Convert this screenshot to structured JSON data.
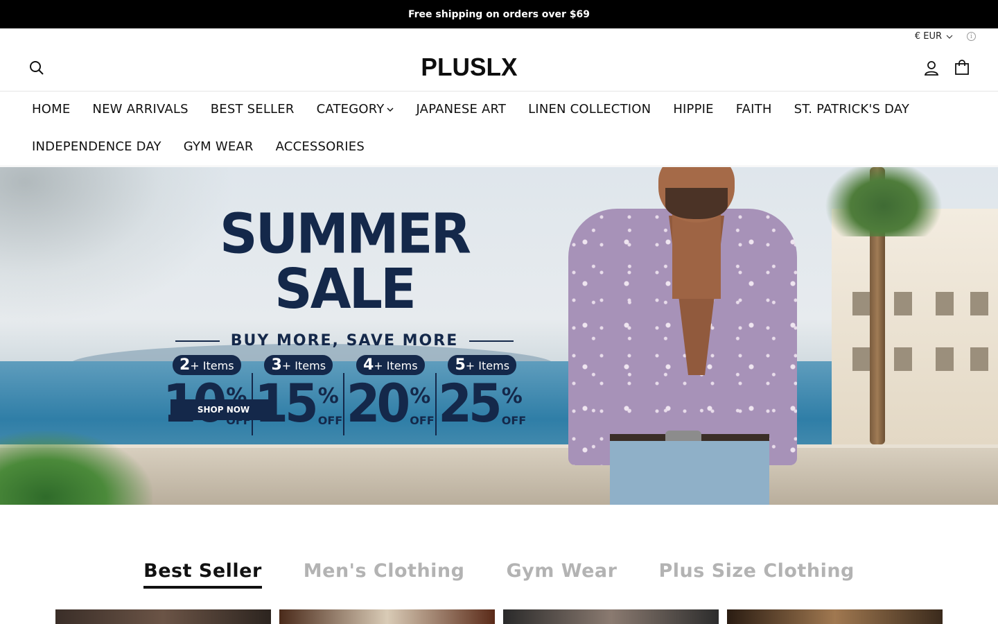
{
  "announcement": "Free shipping on orders over $69",
  "header": {
    "currency": "€ EUR",
    "logo": "PLUSLX"
  },
  "nav": {
    "row1": [
      "HOME",
      "NEW ARRIVALS",
      "BEST SELLER",
      "CATEGORY",
      "JAPANESE ART",
      "LINEN COLLECTION",
      "HIPPIE",
      "FAITH",
      "ST. PATRICK'S DAY"
    ],
    "row2": [
      "INDEPENDENCE DAY",
      "GYM WEAR",
      "ACCESSORIES"
    ]
  },
  "hero": {
    "title": "SUMMER SALE",
    "subtitle": "BUY MORE, SAVE MORE",
    "tiers": [
      {
        "count": "2",
        "label": "+ Items",
        "percent": "10",
        "symbol": "%",
        "off": "OFF"
      },
      {
        "count": "3",
        "label": "+ Items",
        "percent": "15",
        "symbol": "%",
        "off": "OFF"
      },
      {
        "count": "4",
        "label": "+ Items",
        "percent": "20",
        "symbol": "%",
        "off": "OFF"
      },
      {
        "count": "5",
        "label": "+ Items",
        "percent": "25",
        "symbol": "%",
        "off": "OFF"
      }
    ],
    "cta": "SHOP NOW"
  },
  "tabs": [
    "Best Seller",
    "Men's Clothing",
    "Gym Wear",
    "Plus Size Clothing"
  ],
  "active_tab": "Best Seller",
  "colors": {
    "navy": "#14284a",
    "announcement_bg": "#000000",
    "tab_inactive": "#b3b3b3"
  }
}
